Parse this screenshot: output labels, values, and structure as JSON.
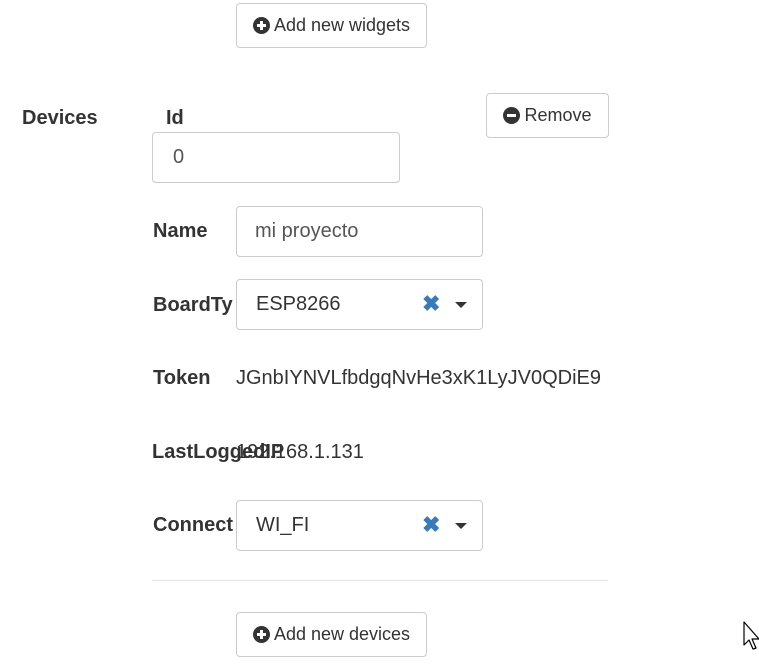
{
  "widgets": {
    "add_label": "Add new widgets"
  },
  "devices": {
    "section_label": "Devices",
    "remove_label": "Remove",
    "id": {
      "label": "Id",
      "value": "0"
    },
    "name": {
      "label": "Name",
      "value": "mi proyecto"
    },
    "board_type": {
      "label": "BoardTy",
      "value": "ESP8266",
      "clear_glyph": "✖"
    },
    "token": {
      "label": "Token",
      "value": "JGnbIYNVLfbdgqNvHe3xK1LyJV0QDiE9"
    },
    "last_logged_ip": {
      "label": "LastLoggedIP",
      "value": "192.168.1.131"
    },
    "connect": {
      "label": "Connect",
      "value": "WI_FI",
      "clear_glyph": "✖"
    },
    "add_label": "Add new devices"
  },
  "icons": {
    "add": "plus-circle-icon",
    "remove": "minus-circle-icon",
    "clear": "close-icon",
    "dropdown": "caret-down-icon",
    "cursor": "mouse-pointer-icon"
  },
  "colors": {
    "text": "#333333",
    "border": "#cccccc",
    "clear_accent": "#3a7ab8"
  }
}
